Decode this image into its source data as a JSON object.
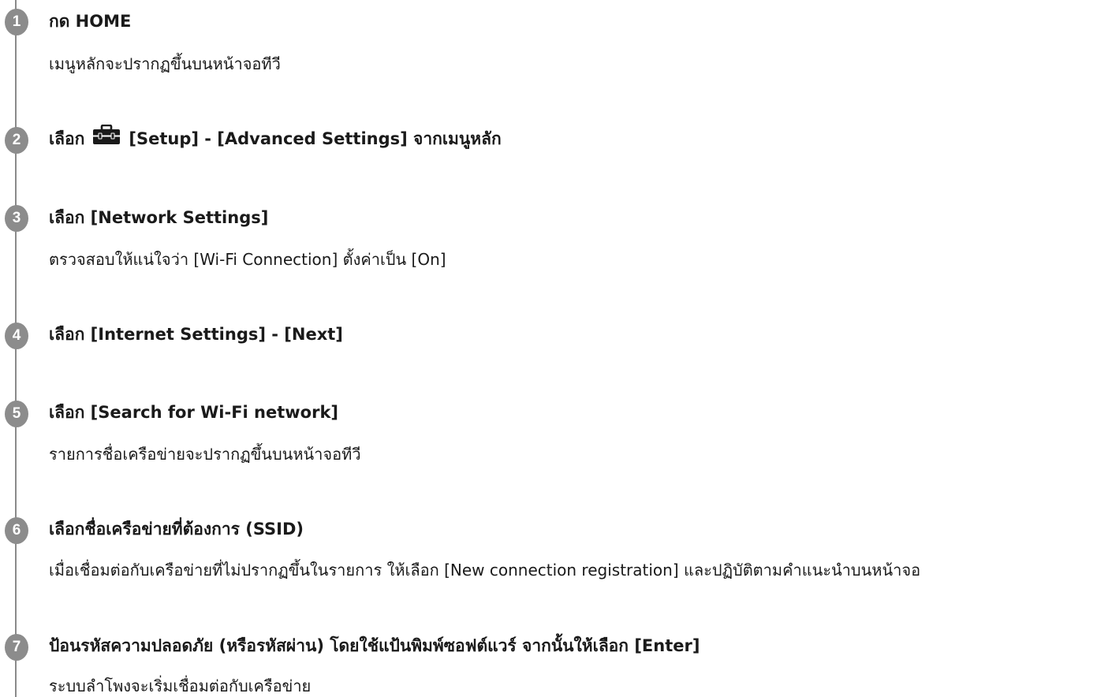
{
  "steps": [
    {
      "number": "1",
      "title": "กด HOME",
      "description": "เมนูหลักจะปรากฏขึ้นบนหน้าจอทีวี"
    },
    {
      "number": "2",
      "title_prefix": "เลือก",
      "icon": "toolbox-icon",
      "title_suffix": "[Setup] - [Advanced Settings] จากเมนูหลัก"
    },
    {
      "number": "3",
      "title": "เลือก [Network Settings]",
      "description": "ตรวจสอบให้แน่ใจว่า [Wi-Fi Connection] ตั้งค่าเป็น [On]"
    },
    {
      "number": "4",
      "title": "เลือก [Internet Settings] - [Next]"
    },
    {
      "number": "5",
      "title": "เลือก [Search for Wi-Fi network]",
      "description": "รายการชื่อเครือข่ายจะปรากฏขึ้นบนหน้าจอทีวี"
    },
    {
      "number": "6",
      "title": "เลือกชื่อเครือข่ายที่ต้องการ (SSID)",
      "description": "เมื่อเชื่อมต่อกับเครือข่ายที่ไม่ปรากฏขึ้นในรายการ ให้เลือก [New connection registration] และปฏิบัติตามคำแนะนำบนหน้าจอ"
    },
    {
      "number": "7",
      "title": "ป้อนรหัสความปลอดภัย (หรือรหัสผ่าน) โดยใช้แป้นพิมพ์ซอฟต์แวร์ จากนั้นให้เลือก [Enter]",
      "description": "ระบบลำโพงจะเริ่มเชื่อมต่อกับเครือข่าย"
    }
  ]
}
